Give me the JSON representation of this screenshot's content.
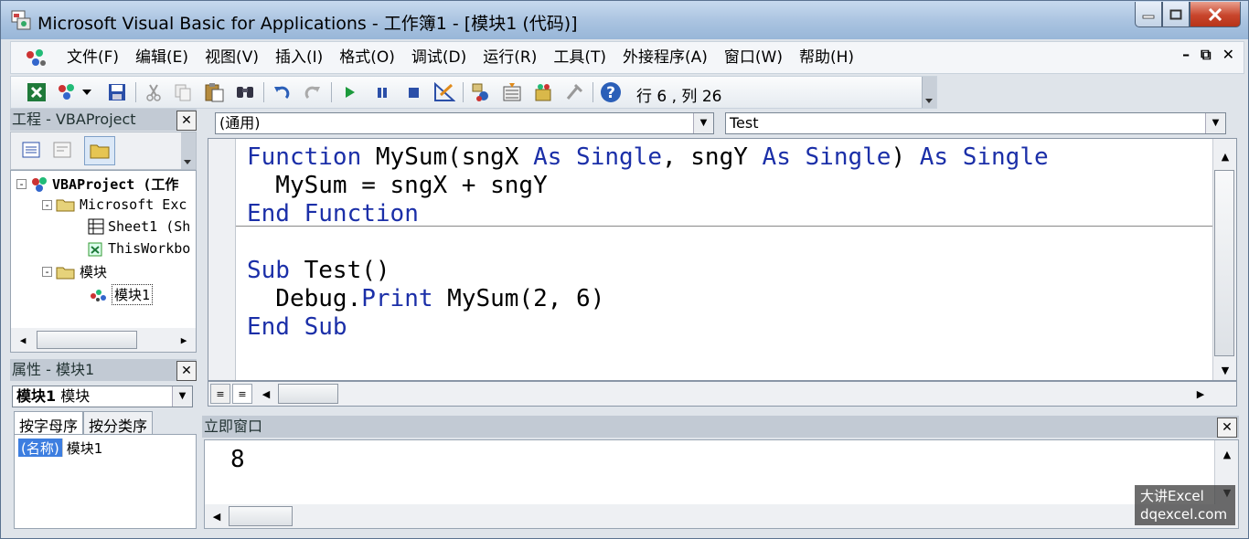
{
  "window": {
    "title": "Microsoft Visual Basic for Applications - 工作簿1 - [模块1 (代码)]"
  },
  "menu": {
    "items": [
      "文件(F)",
      "编辑(E)",
      "视图(V)",
      "插入(I)",
      "格式(O)",
      "调试(D)",
      "运行(R)",
      "工具(T)",
      "外接程序(A)",
      "窗口(W)",
      "帮助(H)"
    ]
  },
  "toolbar": {
    "position": "行 6 , 列 26"
  },
  "project": {
    "header": "工程 - VBAProject",
    "root": "VBAProject (工作",
    "excel_folder": "Microsoft Exc",
    "sheet1": "Sheet1 (Sh",
    "thisworkbook": "ThisWorkbo",
    "modules_folder": "模块",
    "module1": "模块1"
  },
  "properties": {
    "header": "属性 - 模块1",
    "object_name": "模块1",
    "object_type": "模块",
    "tab_alpha": "按字母序",
    "tab_category": "按分类序",
    "prop_name": "(名称)",
    "prop_value": "模块1"
  },
  "code_window": {
    "object_combo": "(通用)",
    "proc_combo": "Test"
  },
  "immediate": {
    "header": "立即窗口",
    "output": "8"
  },
  "watermark": {
    "line1": "大讲Excel",
    "line2": "dqexcel.com"
  },
  "colors": {
    "keyword": "#1b2fa8",
    "title_bar": "#a9c3e0",
    "close_button": "#c8452c"
  }
}
